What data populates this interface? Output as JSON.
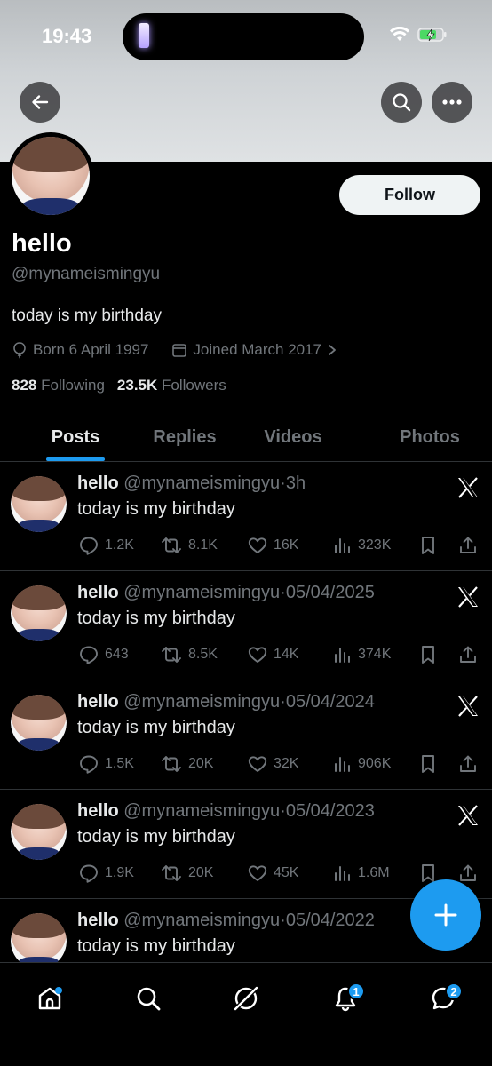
{
  "status_bar": {
    "time": "19:43"
  },
  "profile": {
    "follow_label": "Follow",
    "display_name": "hello",
    "handle": "@mynameismingyu",
    "bio": "today is my birthday",
    "born": "Born 6 April 1997",
    "joined": "Joined March 2017",
    "following_count": "828",
    "following_label": "Following",
    "followers_count": "23.5K",
    "followers_label": "Followers"
  },
  "tabs": [
    {
      "label": "Posts"
    },
    {
      "label": "Replies"
    },
    {
      "label": "Videos"
    },
    {
      "label": "Photos"
    }
  ],
  "posts": [
    {
      "name": "hello",
      "handle": "@mynameismingyu",
      "time": "·3h",
      "text": "today is my birthday",
      "replies": "1.2K",
      "reposts": "8.1K",
      "likes": "16K",
      "views": "323K"
    },
    {
      "name": "hello",
      "handle": "@mynameismingyu",
      "time": "·05/04/2025",
      "text": "today is my birthday",
      "replies": "643",
      "reposts": "8.5K",
      "likes": "14K",
      "views": "374K"
    },
    {
      "name": "hello",
      "handle": "@mynameismingyu",
      "time": "·05/04/2024",
      "text": "today is my birthday",
      "replies": "1.5K",
      "reposts": "20K",
      "likes": "32K",
      "views": "906K"
    },
    {
      "name": "hello",
      "handle": "@mynameismingyu",
      "time": "·05/04/2023",
      "text": "today is my birthday",
      "replies": "1.9K",
      "reposts": "20K",
      "likes": "45K",
      "views": "1.6M"
    },
    {
      "name": "hello",
      "handle": "@mynameismingyu",
      "time": "·05/04/2022",
      "text": "today is my birthday"
    }
  ],
  "nav": {
    "notifications_badge": "1",
    "messages_badge": "2"
  },
  "colors": {
    "accent": "#1d9bf0",
    "muted": "#71767b",
    "text": "#e7e9ea",
    "background": "#000000"
  }
}
